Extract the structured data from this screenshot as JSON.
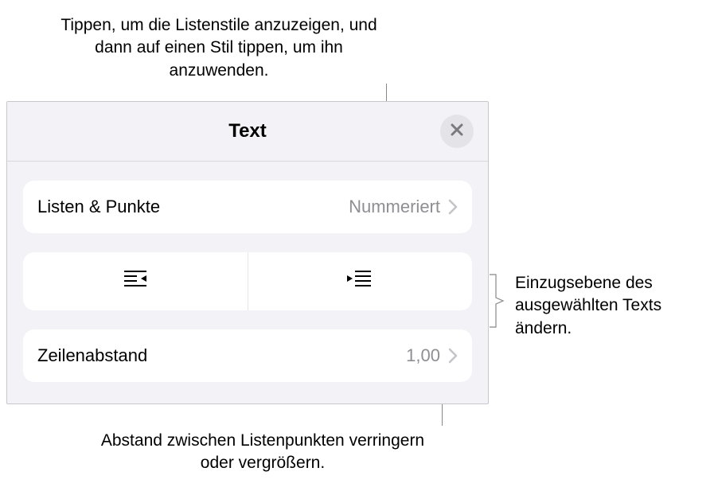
{
  "callouts": {
    "top": "Tippen, um die Listenstile anzuzeigen, und dann auf einen Stil tippen, um ihn anzuwenden.",
    "right": "Einzugsebene des ausgewählten Texts ändern.",
    "bottom": "Abstand zwischen Listenpunkten verringern oder vergrößern."
  },
  "panel": {
    "title": "Text",
    "lists_bullets": {
      "label": "Listen & Punkte",
      "value": "Nummeriert"
    },
    "line_spacing": {
      "label": "Zeilenabstand",
      "value": "1,00"
    }
  }
}
